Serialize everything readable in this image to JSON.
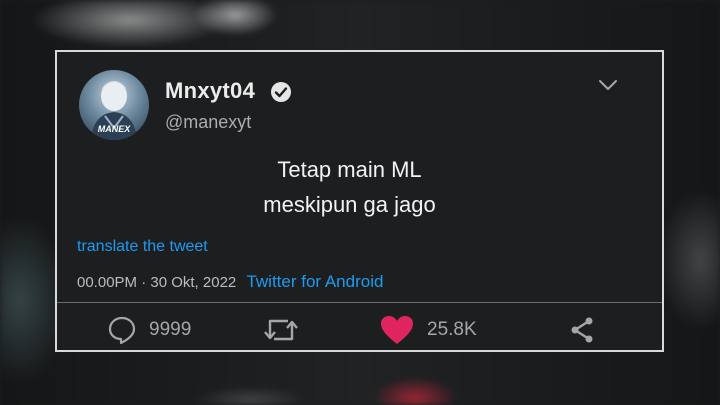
{
  "tweet": {
    "display_name": "Mnxyt04",
    "handle": "@manexyt",
    "avatar_label": "MANEX",
    "text_lines": [
      "Tetap main ML",
      "meskipun ga jago"
    ],
    "translate_link": "translate the tweet",
    "timestamp": "00.00PM · 30 Okt, 2022",
    "client": "Twitter for Android",
    "actions": {
      "reply_count": "9999",
      "like_count": "25.8K"
    }
  },
  "icons": {
    "verified": "verified-badge-icon",
    "more": "chevron-down-icon",
    "reply": "reply-icon",
    "retweet": "retweet-icon",
    "like": "heart-icon",
    "share": "share-icon"
  },
  "colors": {
    "accent": "#1d9bf0",
    "like": "#e0245e",
    "card_border": "#d9d9d9"
  }
}
